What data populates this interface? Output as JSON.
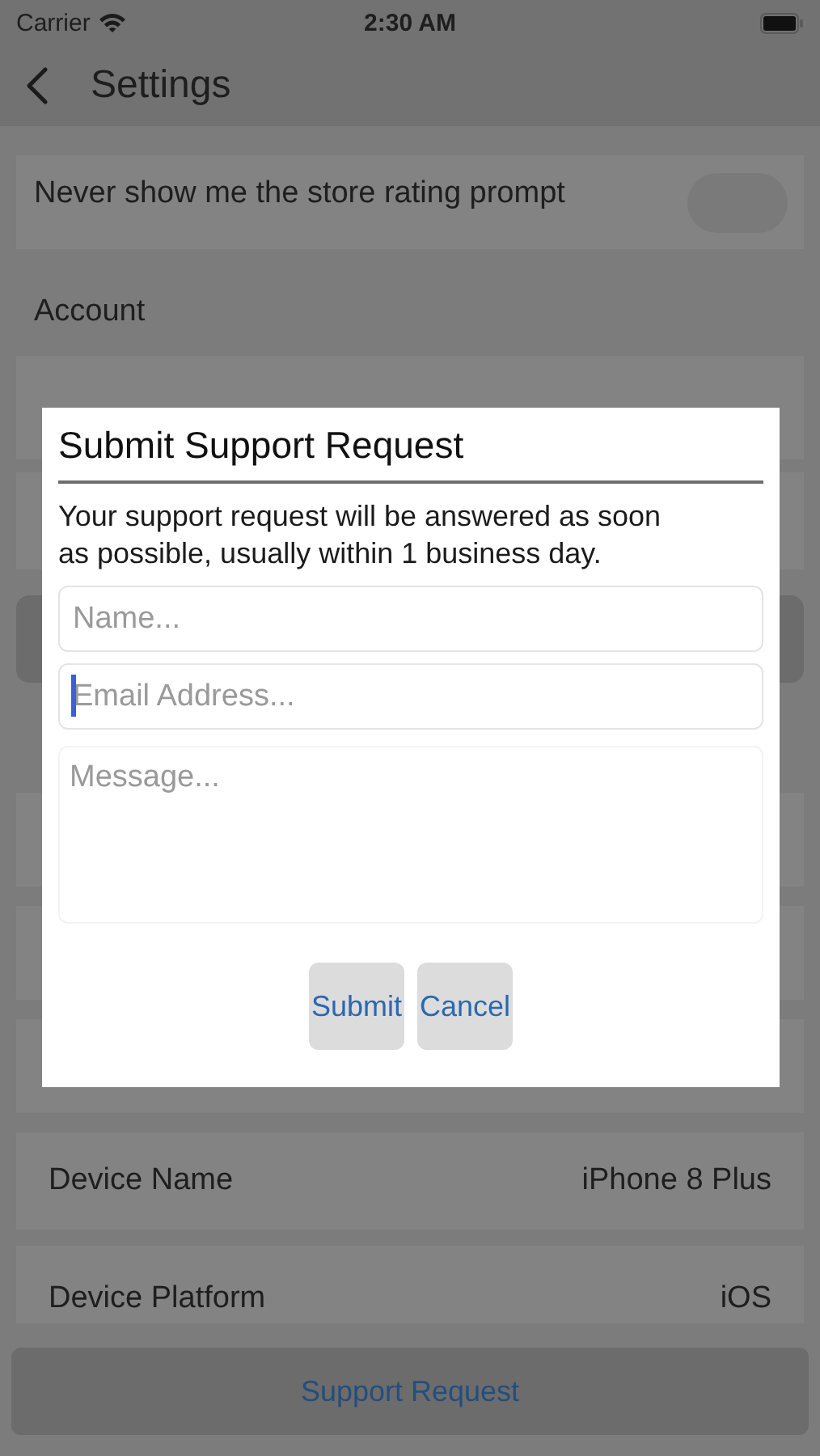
{
  "status_bar": {
    "carrier": "Carrier",
    "time": "2:30 AM"
  },
  "nav": {
    "title": "Settings"
  },
  "rating_toggle": {
    "label": "Never show me the store rating prompt",
    "on": false
  },
  "account_header": "Account",
  "device_rows": [
    {
      "label": "Device Name",
      "value": "iPhone 8 Plus"
    },
    {
      "label": "Device Platform",
      "value": "iOS"
    }
  ],
  "support_button": "Support Request",
  "dialog": {
    "title": "Submit Support Request",
    "message": "Your support request will be answered as soon as possible, usually within 1 business day.",
    "fields": [
      {
        "placeholder": "Name...",
        "focused": false,
        "kind": "line"
      },
      {
        "placeholder": "Email Address...",
        "focused": true,
        "kind": "line"
      },
      {
        "placeholder": "Message...",
        "focused": false,
        "kind": "area"
      }
    ],
    "buttons": [
      "Submit",
      "Cancel"
    ]
  }
}
